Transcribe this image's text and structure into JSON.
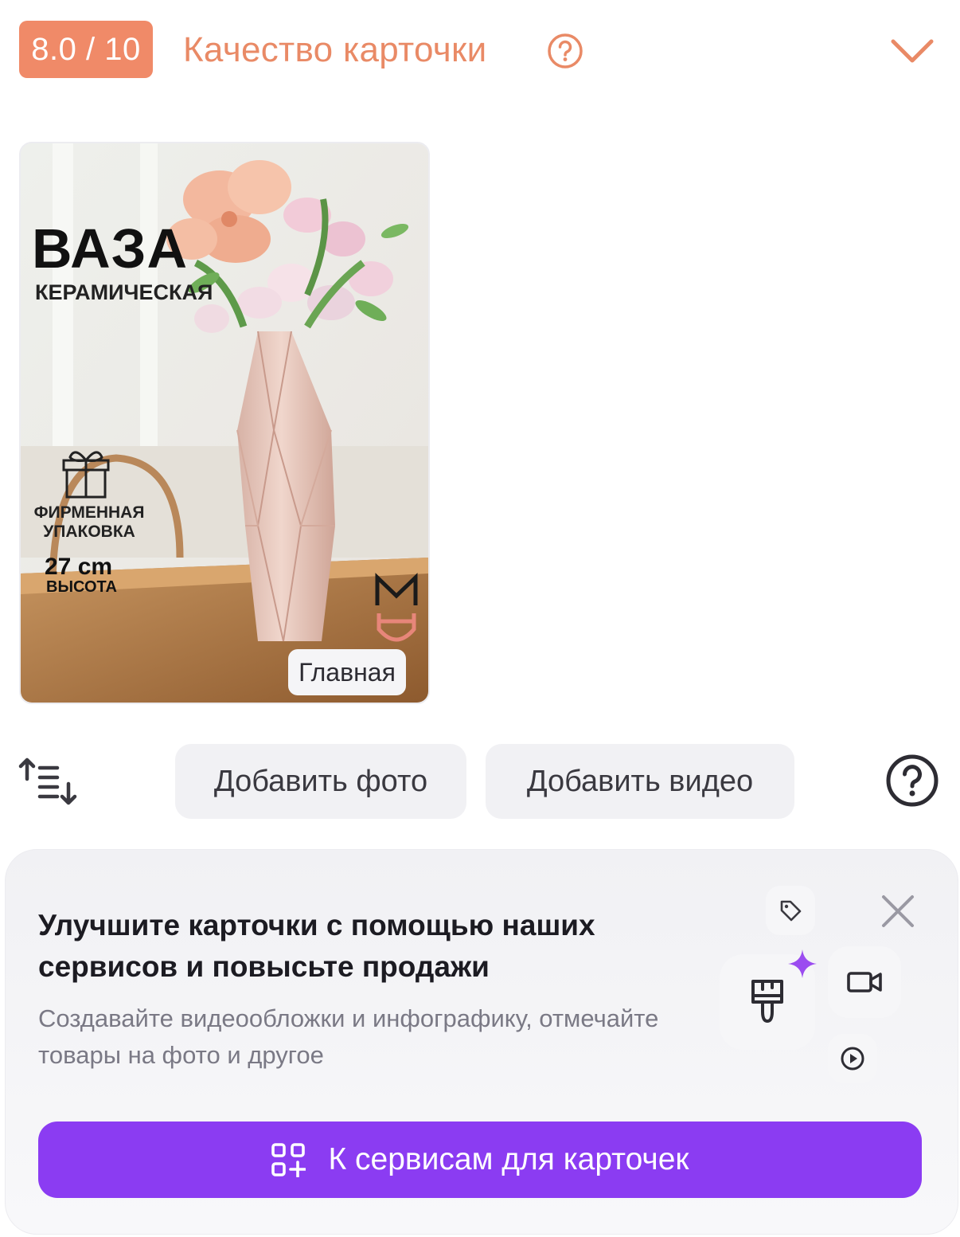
{
  "header": {
    "score": "8.0 / 10",
    "title": "Качество карточки",
    "help_icon": "question-circle-icon",
    "collapse_icon": "chevron-down-icon",
    "accent_color": "#f08a68"
  },
  "photo": {
    "title": "ВАЗА",
    "subtitle": "КЕРАМИЧЕСКАЯ",
    "packaging": "ФИРМЕННАЯ УПАКОВКА",
    "height_value": "27 cm",
    "height_label": "ВЫСОТА",
    "badge": "Главная"
  },
  "toolbar": {
    "sort_icon": "sort-icon",
    "add_photo": "Добавить фото",
    "add_video": "Добавить видео",
    "help_icon": "question-circle-icon"
  },
  "promo": {
    "title": "Улучшите карточки с помощью наших сервисов и повысьте продажи",
    "description": "Создавайте видеообложки и инфографику, отмечайте товары на фото и другое",
    "cta_label": "К сервисам для карточек",
    "cta_color": "#8b3cf2",
    "icons": [
      "tag-icon",
      "paint-brush-icon",
      "video-camera-icon",
      "play-icon",
      "sparkle-icon",
      "close-icon",
      "grid-plus-icon"
    ]
  }
}
